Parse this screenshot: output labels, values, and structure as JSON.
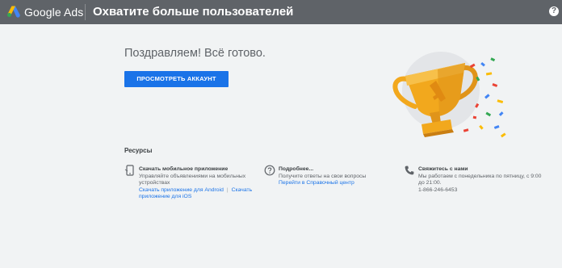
{
  "header": {
    "brand": "Google Ads",
    "title": "Охватите больше пользователей",
    "help_icon": "help-icon",
    "help_glyph": "?"
  },
  "main": {
    "congrats": "Поздравляем! Всё готово.",
    "view_account_label": "ПРОСМОТРЕТЬ АККАУНТ",
    "illustration": "trophy-illustration"
  },
  "resources": {
    "title": "Ресурсы",
    "mobile": {
      "icon": "phone-icon",
      "heading": "Скачать мобильное приложение",
      "description": "Управляйте объявлениями на мобильных устройствах",
      "android_link": "Скачать приложение для Android",
      "separator": "|",
      "ios_link": "Скачать приложение для iOS"
    },
    "more": {
      "icon": "question-icon",
      "heading": "Подробнее...",
      "description": "Получите ответы на свои вопросы",
      "help_center_link": "Перейти в Справочный центр"
    },
    "contact": {
      "icon": "telephone-icon",
      "heading": "Свяжитесь с нами",
      "hours": "Мы работаем с понедельника по пятницу, с 9:00 до 21:00.",
      "phone": "1-866-246-6453"
    }
  },
  "colors": {
    "topbar": "#5f6368",
    "background": "#f1f3f4",
    "accent": "#1a73e8",
    "trophy_gold": "#f2a81d"
  }
}
